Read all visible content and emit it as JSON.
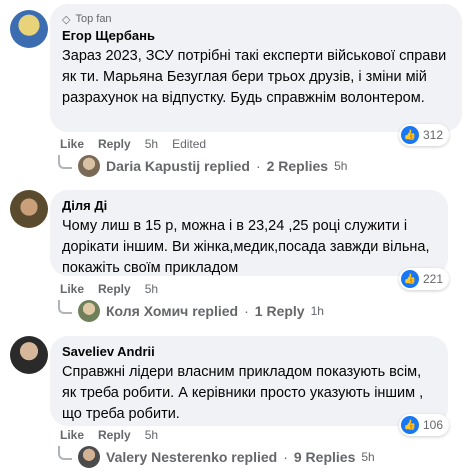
{
  "comments": [
    {
      "badge": "Top fan",
      "author": "Егор Щербань",
      "text": "Зараз 2023, ЗСУ потрібні такі експерти військової справи як ти. Марьяна Безуглая бери трьох друзів, і зміни мій разрахунок на відпустку. Будь справжнім волонтером.",
      "reactions": "312",
      "like": "Like",
      "reply": "Reply",
      "time": "5h",
      "edited": "Edited",
      "replies_author": "Daria Kapustij replied",
      "replies_count": "2 Replies",
      "replies_time": "5h"
    },
    {
      "author": "Діля Ді",
      "text": "Чому лиш в 15 р, можна і в 23,24 ,25 році служити і дорікати іншим. Ви жінка,медик,посада завжди вільна, покажіть своїм прикладом",
      "reactions": "221",
      "like": "Like",
      "reply": "Reply",
      "time": "5h",
      "replies_author": "Коля Хомич replied",
      "replies_count": "1 Reply",
      "replies_time": "1h"
    },
    {
      "author": "Saveliev Andrii",
      "text": "Справжні лідери власним прикладом показують всім, як треба робити. А керівники просто указують іншим , що треба робити.",
      "reactions": "106",
      "like": "Like",
      "reply": "Reply",
      "time": "5h",
      "replies_author": "Valery Nesterenko replied",
      "replies_count": "9 Replies",
      "replies_time": "5h"
    }
  ],
  "separator": "·",
  "colors": {
    "accent": "#1877f2",
    "bubble": "#f0f2f5",
    "muted": "#65676b"
  },
  "icons": {
    "badge": "diamond-icon",
    "reaction": "thumbs-up-icon"
  }
}
